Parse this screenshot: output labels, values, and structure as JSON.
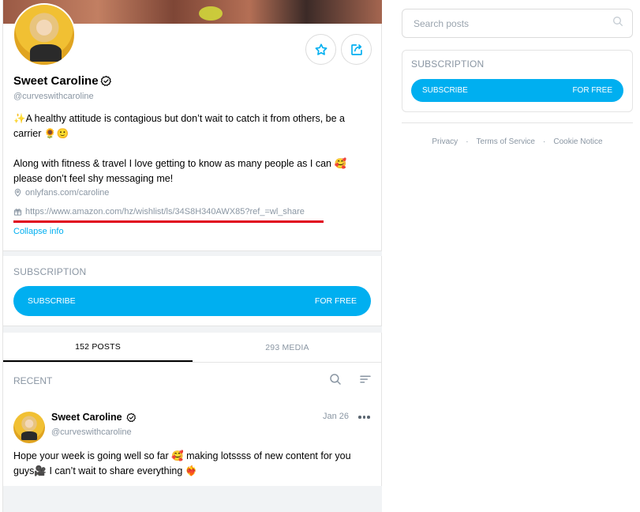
{
  "profile": {
    "name": "Sweet Caroline",
    "handle": "@curveswithcaroline",
    "bio_line_1": "✨A healthy attitude is contagious but don’t wait to catch it from others, be a carrier 🌻🙂",
    "bio_line_2": "Along with fitness & travel I love getting to know as many people as I can 🥰 please don’t feel shy messaging me!",
    "location_link": "onlyfans.com/caroline",
    "wishlist_link": "https://www.amazon.com/hz/wishlist/ls/34S8H340AWX85?ref_=wl_share",
    "collapse_label": "Collapse info",
    "icons": {
      "favorite": "star-icon",
      "share": "share-icon",
      "verified": "verified-badge-icon",
      "location": "location-pin-icon",
      "gift": "gift-icon"
    }
  },
  "subscription": {
    "title": "SUBSCRIPTION",
    "button_label": "SUBSCRIBE",
    "price_label": "FOR FREE"
  },
  "tabs": [
    {
      "label": "152 POSTS",
      "active": true
    },
    {
      "label": "293 MEDIA",
      "active": false
    }
  ],
  "feed": {
    "section_label": "RECENT",
    "icons": {
      "search": "search-icon",
      "sort": "sort-icon"
    }
  },
  "post": {
    "author": "Sweet Caroline",
    "handle": "@curveswithcaroline",
    "date": "Jan 26",
    "text": "Hope your week is going well so far 🥰 making lotssss of new content for you guys🎥 I can’t wait to share everything ❤️‍🔥"
  },
  "sidebar": {
    "search_placeholder": "Search posts",
    "subscription_title": "SUBSCRIPTION",
    "subscribe_label": "SUBSCRIBE",
    "price_label": "FOR FREE",
    "footer_links": [
      "Privacy",
      "Terms of Service",
      "Cookie Notice"
    ]
  },
  "colors": {
    "accent": "#00aff0",
    "muted_text": "#8a96a3",
    "highlight_underline": "#e0001b"
  }
}
